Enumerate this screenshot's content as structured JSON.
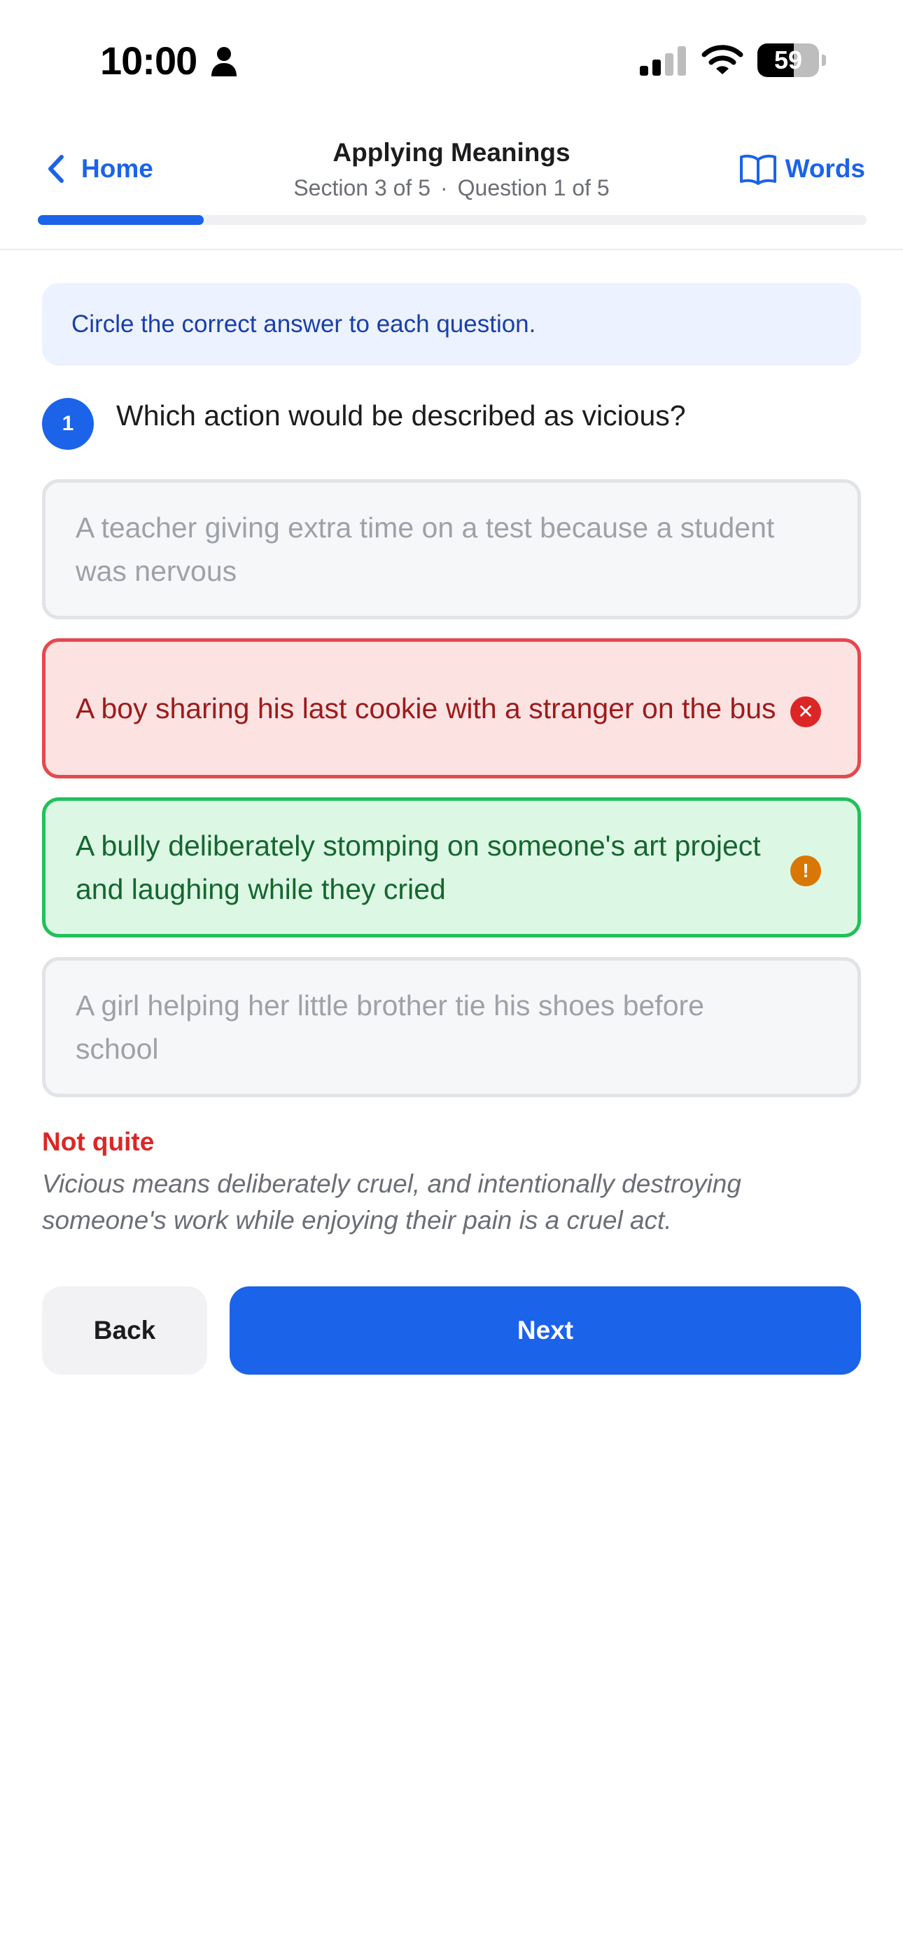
{
  "status_bar": {
    "time": "10:00",
    "battery_level": "59",
    "battery_fraction": 0.59
  },
  "header": {
    "back_label": "Home",
    "title": "Applying Meanings",
    "section": "Section 3 of 5",
    "separator": "·",
    "question_position": "Question 1 of 5",
    "words_label": "Words",
    "progress": 0.2
  },
  "instruction": "Circle the correct answer to each question.",
  "question": {
    "number": "1",
    "text": "Which action would be described as vicious?"
  },
  "options": [
    {
      "text": "A teacher giving extra time on a test because a student was nervous",
      "state": "neutral"
    },
    {
      "text": "A boy sharing his last cookie with a stranger on the bus",
      "state": "selected-wrong",
      "badge": "✕"
    },
    {
      "text": "A bully deliberately stomping on someone's art project and laughing while they cried",
      "state": "correct",
      "badge": "!"
    },
    {
      "text": "A girl helping her little brother tie his shoes before school",
      "state": "neutral"
    }
  ],
  "feedback": {
    "title": "Not quite",
    "explanation": "Vicious means deliberately cruel, and intentionally destroying someone's work while enjoying their pain is a cruel act."
  },
  "buttons": {
    "back": "Back",
    "next": "Next"
  },
  "colors": {
    "accent": "#1b63e8",
    "wrong": "#e5484d",
    "correct": "#22c05a",
    "warning": "#d97706"
  },
  "icons": [
    "person-icon",
    "signal-icon",
    "wifi-icon",
    "battery-icon",
    "chevron-left-icon",
    "book-icon",
    "close-icon",
    "exclamation-icon"
  ]
}
